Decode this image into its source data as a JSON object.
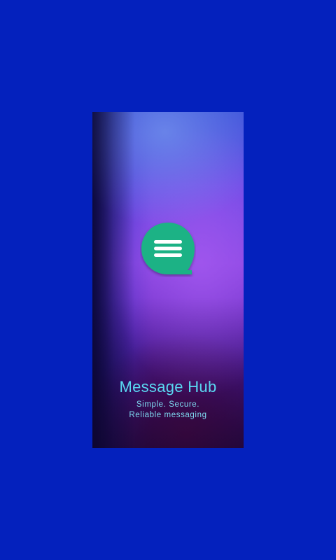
{
  "app": {
    "title": "Message Hub",
    "tagline_line1": "Simple. Secure.",
    "tagline_line2": "Reliable messaging"
  },
  "logo": {
    "icon": "chat-bubble-icon",
    "color": "#1fb285"
  },
  "colors": {
    "background": "#0421bd",
    "title": "#5ad8f2"
  }
}
